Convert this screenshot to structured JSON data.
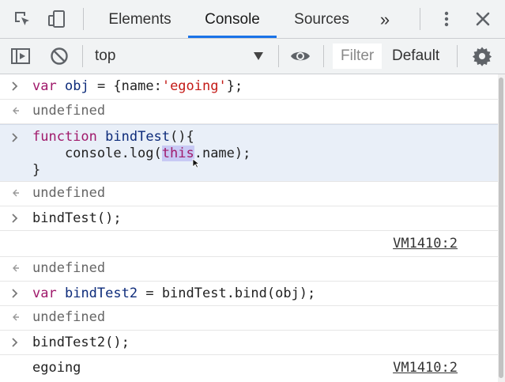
{
  "toolbar": {
    "tabs": [
      {
        "label": "Elements",
        "active": false
      },
      {
        "label": "Console",
        "active": true
      },
      {
        "label": "Sources",
        "active": false
      }
    ],
    "more_tabs_glyph": "»",
    "accent_color": "#1a73e8"
  },
  "console_toolbar": {
    "context": "top",
    "filter_placeholder": "Filter",
    "levels_label": "Default"
  },
  "console": {
    "entries": [
      {
        "type": "input",
        "text": "var obj = {name:'egoing'};"
      },
      {
        "type": "result",
        "text": "undefined"
      },
      {
        "type": "input",
        "text": "function bindTest(){\n    console.log(this.name);\n}"
      },
      {
        "type": "result",
        "text": "undefined"
      },
      {
        "type": "input",
        "text": "bindTest();"
      },
      {
        "type": "log",
        "text": "",
        "source": "VM1410:2"
      },
      {
        "type": "result",
        "text": "undefined"
      },
      {
        "type": "input",
        "text": "var bindTest2 = bindTest.bind(obj);"
      },
      {
        "type": "result",
        "text": "undefined"
      },
      {
        "type": "input",
        "text": "bindTest2();"
      },
      {
        "type": "log",
        "text": "egoing",
        "source": "VM1410:2"
      }
    ]
  }
}
